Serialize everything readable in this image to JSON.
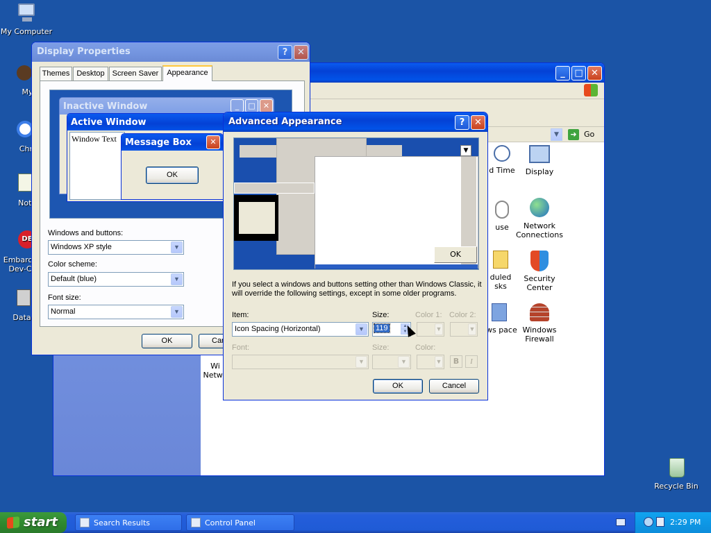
{
  "desktop": {
    "icons": [
      {
        "label": "My Computer"
      },
      {
        "label": "MyPa"
      },
      {
        "label": "Chrom"
      },
      {
        "label": "Notepa"
      },
      {
        "label": "Embarca Dev-C"
      },
      {
        "label": "DataWa"
      },
      {
        "label": "Recycle Bin"
      }
    ]
  },
  "control_panel": {
    "go_label": "Go",
    "items": [
      {
        "label": "d Time"
      },
      {
        "label": "Display"
      },
      {
        "label": "use"
      },
      {
        "label": "Network Connections"
      },
      {
        "label": "duled sks"
      },
      {
        "label": "Security Center"
      },
      {
        "label": "ows pace"
      },
      {
        "label": "Windows Firewall"
      },
      {
        "label": "Wi Netwo"
      }
    ]
  },
  "display_properties": {
    "title": "Display Properties",
    "tabs": [
      "Themes",
      "Desktop",
      "Screen Saver",
      "Appearance"
    ],
    "preview": {
      "inactive_title": "Inactive Window",
      "active_title": "Active Window",
      "window_text": "Window Text",
      "msgbox_title": "Message Box",
      "msgbox_ok": "OK"
    },
    "windows_buttons_label": "Windows and buttons:",
    "windows_buttons_value": "Windows XP style",
    "color_scheme_label": "Color scheme:",
    "color_scheme_value": "Default (blue)",
    "font_size_label": "Font size:",
    "font_size_value": "Normal",
    "ok_label": "OK",
    "cancel_label": "Car"
  },
  "advanced_appearance": {
    "title": "Advanced Appearance",
    "preview_ok": "OK",
    "note": "If you select a windows and buttons setting other than Windows Classic, it will override the following settings, except in some older programs.",
    "item_label": "Item:",
    "item_value": "Icon Spacing (Horizontal)",
    "size_label": "Size:",
    "size_value": "119",
    "color1_label": "Color 1:",
    "color2_label": "Color 2:",
    "font_label": "Font:",
    "font_size_label": "Size:",
    "font_color_label": "Color:",
    "bold_label": "B",
    "italic_label": "I",
    "ok_label": "OK",
    "cancel_label": "Cancel"
  },
  "taskbar": {
    "start_label": "start",
    "tasks": [
      {
        "label": "Search Results"
      },
      {
        "label": "Control Panel"
      }
    ],
    "clock": "2:29 PM"
  }
}
